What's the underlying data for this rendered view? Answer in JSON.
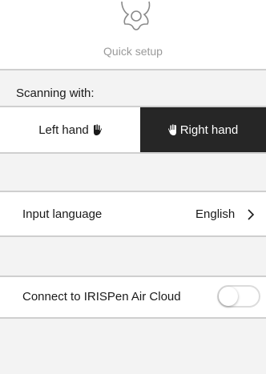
{
  "header": {
    "title": "Quick setup",
    "icon": "gear-icon"
  },
  "scanning": {
    "label": "Scanning with:",
    "left_option": "Left hand",
    "right_option": "Right hand",
    "selected": "Right hand",
    "selected_color": "#262626"
  },
  "input_language": {
    "label": "Input language",
    "value": "English"
  },
  "cloud": {
    "label": "Connect to IRISPen Air Cloud",
    "enabled": false
  }
}
